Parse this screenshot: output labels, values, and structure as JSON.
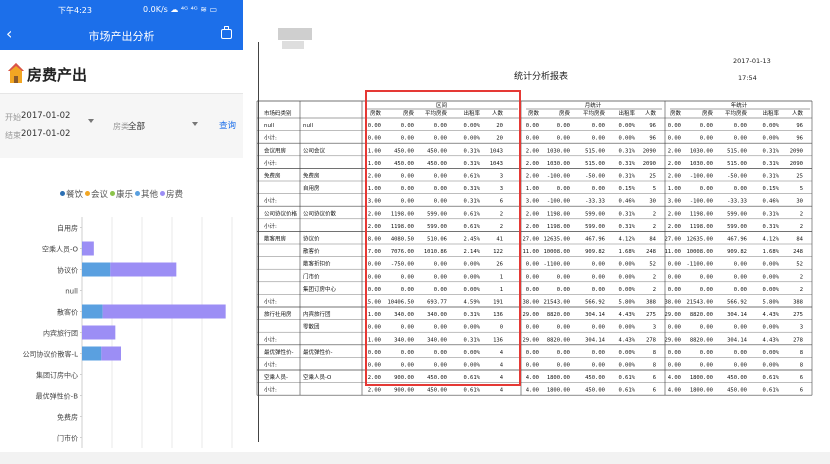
{
  "phone": {
    "status": {
      "time": "下午4:23",
      "network": "0.0K/s ☁ ⁴ᴳ ⁴ᴳ ≋ ▭"
    },
    "nav": {
      "title": "市场产出分析",
      "back_icon": "‹"
    },
    "section_title": "房费产出",
    "filters": {
      "start_label": "开始",
      "start_value": "2017-01-02",
      "end_label": "结束",
      "end_value": "2017-01-02",
      "room_label": "房类",
      "room_value": "全部",
      "query_label": "查询"
    },
    "legend": [
      {
        "name": "餐饮",
        "color": "#2c6fb3"
      },
      {
        "name": "会议",
        "color": "#f2a623"
      },
      {
        "name": "康乐",
        "color": "#8bc34a"
      },
      {
        "name": "其他",
        "color": "#5aa0e0"
      },
      {
        "name": "房费",
        "color": "#9c8ef5"
      }
    ],
    "chart_data": {
      "type": "bar",
      "orientation": "horizontal",
      "stacked": true,
      "categories": [
        "自用房",
        "空乘人员-O",
        "协议价",
        "null",
        "散客价",
        "内宾旅行团",
        "公司协议价散客-L",
        "集团订房中心",
        "最优弹性价-B",
        "免费房",
        "门市价"
      ],
      "series": [
        {
          "name": "其他",
          "values": [
            0,
            5,
            850,
            0,
            620,
            0,
            580,
            0,
            0,
            0,
            0
          ]
        },
        {
          "name": "房费",
          "values": [
            0,
            350,
            1980,
            0,
            3690,
            1000,
            590,
            0,
            0,
            0,
            0
          ]
        }
      ],
      "xlim": [
        0,
        4500
      ],
      "grid": true
    }
  },
  "report": {
    "title": "统计分析报表",
    "date": "2017-01-13",
    "clock": "17:54",
    "groups": [
      "区间",
      "月统计",
      "年统计"
    ],
    "header_label": "市场码类别",
    "columns": [
      "房数",
      "房费",
      "平均房费",
      "出租率",
      "人数"
    ],
    "rows": [
      {
        "cat": "null",
        "sub": "null",
        "v": [
          [
            "0.00",
            "0.00",
            "0.00",
            "0.00%",
            "20"
          ],
          [
            "0.00",
            "0.00",
            "0.00",
            "0.00%",
            "96"
          ],
          [
            "0.00",
            "0.00",
            "0.00",
            "0.00%",
            "96"
          ]
        ]
      },
      {
        "cat": "小计:",
        "sub": "",
        "v": [
          [
            "0.00",
            "0.00",
            "0.00",
            "0.00%",
            "20"
          ],
          [
            "0.00",
            "0.00",
            "0.00",
            "0.00%",
            "96"
          ],
          [
            "0.00",
            "0.00",
            "0.00",
            "0.00%",
            "96"
          ]
        ]
      },
      {
        "cat": "会议用房",
        "sub": "公司会议",
        "v": [
          [
            "1.00",
            "450.00",
            "450.00",
            "0.31%",
            "1043"
          ],
          [
            "2.00",
            "1030.00",
            "515.00",
            "0.31%",
            "2090"
          ],
          [
            "2.00",
            "1030.00",
            "515.00",
            "0.31%",
            "2090"
          ]
        ]
      },
      {
        "cat": "小计:",
        "sub": "",
        "v": [
          [
            "1.00",
            "450.00",
            "450.00",
            "0.31%",
            "1043"
          ],
          [
            "2.00",
            "1030.00",
            "515.00",
            "0.31%",
            "2090"
          ],
          [
            "2.00",
            "1030.00",
            "515.00",
            "0.31%",
            "2090"
          ]
        ]
      },
      {
        "cat": "免费房",
        "sub": "免费房",
        "v": [
          [
            "2.00",
            "0.00",
            "0.00",
            "0.61%",
            "3"
          ],
          [
            "2.00",
            "-100.00",
            "-50.00",
            "0.31%",
            "25"
          ],
          [
            "2.00",
            "-100.00",
            "-50.00",
            "0.31%",
            "25"
          ]
        ]
      },
      {
        "cat": "",
        "sub": "自用房",
        "v": [
          [
            "1.00",
            "0.00",
            "0.00",
            "0.31%",
            "3"
          ],
          [
            "1.00",
            "0.00",
            "0.00",
            "0.15%",
            "5"
          ],
          [
            "1.00",
            "0.00",
            "0.00",
            "0.15%",
            "5"
          ]
        ]
      },
      {
        "cat": "小计:",
        "sub": "",
        "v": [
          [
            "3.00",
            "0.00",
            "0.00",
            "0.31%",
            "6"
          ],
          [
            "3.00",
            "-100.00",
            "-33.33",
            "0.46%",
            "30"
          ],
          [
            "3.00",
            "-100.00",
            "-33.33",
            "0.46%",
            "30"
          ]
        ]
      },
      {
        "cat": "公司协议价格",
        "sub": "公司协议价散",
        "v": [
          [
            "2.00",
            "1198.00",
            "599.00",
            "0.61%",
            "2"
          ],
          [
            "2.00",
            "1198.00",
            "599.00",
            "0.31%",
            "2"
          ],
          [
            "2.00",
            "1198.00",
            "599.00",
            "0.31%",
            "2"
          ]
        ]
      },
      {
        "cat": "小计:",
        "sub": "",
        "v": [
          [
            "2.00",
            "1198.00",
            "599.00",
            "0.61%",
            "2"
          ],
          [
            "2.00",
            "1198.00",
            "599.00",
            "0.31%",
            "2"
          ],
          [
            "2.00",
            "1198.00",
            "599.00",
            "0.31%",
            "2"
          ]
        ]
      },
      {
        "cat": "散客用房",
        "sub": "协议价",
        "v": [
          [
            "8.00",
            "4080.50",
            "510.06",
            "2.45%",
            "41"
          ],
          [
            "27.00",
            "12635.00",
            "467.96",
            "4.12%",
            "84"
          ],
          [
            "27.00",
            "12635.00",
            "467.96",
            "4.12%",
            "84"
          ]
        ]
      },
      {
        "cat": "",
        "sub": "散客价",
        "v": [
          [
            "7.00",
            "7076.00",
            "1010.86",
            "2.14%",
            "122"
          ],
          [
            "11.00",
            "10008.00",
            "909.82",
            "1.68%",
            "248"
          ],
          [
            "11.00",
            "10008.00",
            "909.82",
            "1.68%",
            "248"
          ]
        ]
      },
      {
        "cat": "",
        "sub": "散客折扣价",
        "v": [
          [
            "0.00",
            "-750.00",
            "0.00",
            "0.00%",
            "26"
          ],
          [
            "0.00",
            "-1100.00",
            "0.00",
            "0.00%",
            "52"
          ],
          [
            "0.00",
            "-1100.00",
            "0.00",
            "0.00%",
            "52"
          ]
        ]
      },
      {
        "cat": "",
        "sub": "门市价",
        "v": [
          [
            "0.00",
            "0.00",
            "0.00",
            "0.00%",
            "1"
          ],
          [
            "0.00",
            "0.00",
            "0.00",
            "0.00%",
            "2"
          ],
          [
            "0.00",
            "0.00",
            "0.00",
            "0.00%",
            "2"
          ]
        ]
      },
      {
        "cat": "",
        "sub": "集团订房中心",
        "v": [
          [
            "0.00",
            "0.00",
            "0.00",
            "0.00%",
            "1"
          ],
          [
            "0.00",
            "0.00",
            "0.00",
            "0.00%",
            "2"
          ],
          [
            "0.00",
            "0.00",
            "0.00",
            "0.00%",
            "2"
          ]
        ]
      },
      {
        "cat": "小计:",
        "sub": "",
        "v": [
          [
            "15.00",
            "10406.50",
            "693.77",
            "4.59%",
            "191"
          ],
          [
            "38.00",
            "21543.00",
            "566.92",
            "5.80%",
            "388"
          ],
          [
            "38.00",
            "21543.00",
            "566.92",
            "5.80%",
            "388"
          ]
        ]
      },
      {
        "cat": "旅行社用房",
        "sub": "内宾旅行团",
        "v": [
          [
            "1.00",
            "340.00",
            "340.00",
            "0.31%",
            "136"
          ],
          [
            "29.00",
            "8820.00",
            "304.14",
            "4.43%",
            "275"
          ],
          [
            "29.00",
            "8820.00",
            "304.14",
            "4.43%",
            "275"
          ]
        ]
      },
      {
        "cat": "",
        "sub": "零散团",
        "v": [
          [
            "0.00",
            "0.00",
            "0.00",
            "0.00%",
            "0"
          ],
          [
            "0.00",
            "0.00",
            "0.00",
            "0.00%",
            "3"
          ],
          [
            "0.00",
            "0.00",
            "0.00",
            "0.00%",
            "3"
          ]
        ]
      },
      {
        "cat": "小计:",
        "sub": "",
        "v": [
          [
            "1.00",
            "340.00",
            "340.00",
            "0.31%",
            "136"
          ],
          [
            "29.00",
            "8820.00",
            "304.14",
            "4.43%",
            "278"
          ],
          [
            "29.00",
            "8820.00",
            "304.14",
            "4.43%",
            "278"
          ]
        ]
      },
      {
        "cat": "最优弹性价-",
        "sub": "最优弹性价-",
        "v": [
          [
            "0.00",
            "0.00",
            "0.00",
            "0.00%",
            "4"
          ],
          [
            "0.00",
            "0.00",
            "0.00",
            "0.00%",
            "8"
          ],
          [
            "0.00",
            "0.00",
            "0.00",
            "0.00%",
            "8"
          ]
        ]
      },
      {
        "cat": "小计:",
        "sub": "",
        "v": [
          [
            "0.00",
            "0.00",
            "0.00",
            "0.00%",
            "4"
          ],
          [
            "0.00",
            "0.00",
            "0.00",
            "0.00%",
            "8"
          ],
          [
            "0.00",
            "0.00",
            "0.00",
            "0.00%",
            "8"
          ]
        ]
      },
      {
        "cat": "空乘人员-",
        "sub": "空乘人员-O",
        "v": [
          [
            "2.00",
            "900.00",
            "450.00",
            "0.61%",
            "4"
          ],
          [
            "4.00",
            "1800.00",
            "450.00",
            "0.61%",
            "6"
          ],
          [
            "4.00",
            "1800.00",
            "450.00",
            "0.61%",
            "6"
          ]
        ]
      },
      {
        "cat": "小计:",
        "sub": "",
        "v": [
          [
            "2.00",
            "900.00",
            "450.00",
            "0.61%",
            "4"
          ],
          [
            "4.00",
            "1800.00",
            "450.00",
            "0.61%",
            "6"
          ],
          [
            "4.00",
            "1800.00",
            "450.00",
            "0.61%",
            "6"
          ]
        ]
      }
    ]
  }
}
